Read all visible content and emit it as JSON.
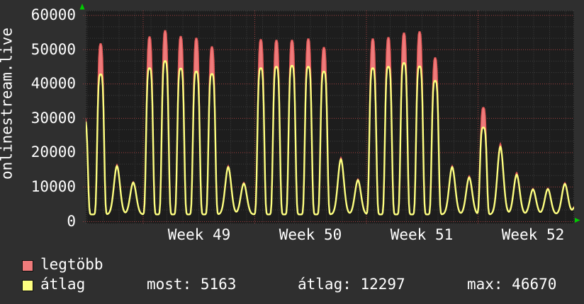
{
  "ylabel": "onlinestream.live",
  "legend": [
    {
      "label": "legtöbb",
      "color": "#ef7b7b",
      "border": "#101010"
    },
    {
      "label": "átlag",
      "color": "#feff80",
      "border": "#101010"
    }
  ],
  "stats": [
    {
      "label": "most:",
      "value": "5163"
    },
    {
      "label": "átlag:",
      "value": "12297"
    },
    {
      "label": "max:",
      "value": "46670"
    }
  ],
  "chart_data": {
    "type": "area",
    "title": "",
    "ylabel": "onlinestream.live",
    "xlabel": "",
    "ylim": [
      0,
      60000
    ],
    "ytick_step": 10000,
    "ytick_labels": [
      "0",
      "10000",
      "20000",
      "30000",
      "40000",
      "50000",
      "60000"
    ],
    "x_tick_labels": [
      "Week 49",
      "Week 50",
      "Week 51",
      "Week 52"
    ],
    "grid": true,
    "legend_position": "bottom-left",
    "colors": {
      "max_fill": "#ef7b7b",
      "max_line": "#e25454",
      "avg_line": "#feff80",
      "grid_minor": "#3e3e3e",
      "grid_major": "#9e4040",
      "plot_bg": "#1d1d1d",
      "page_bg": "#2f2f2f",
      "arrow": "#00cc00",
      "text": "#ffffff"
    },
    "baseline": 2000,
    "series": [
      {
        "name": "legtöbb",
        "kind": "band-max",
        "color": "#ef7b7b"
      },
      {
        "name": "átlag",
        "kind": "line-avg",
        "color": "#feff80"
      }
    ],
    "days": [
      {
        "off": -2,
        "max": 30500,
        "avg": 29500,
        "shape": "spike"
      },
      {
        "off": 21,
        "max": 51800,
        "avg": 42800,
        "shape": "spike"
      },
      {
        "off": 44,
        "max": 16600,
        "avg": 16100,
        "shape": "bump"
      },
      {
        "off": 67,
        "max": 11600,
        "avg": 11300,
        "shape": "bump"
      },
      {
        "off": 90,
        "max": 53800,
        "avg": 44600,
        "shape": "spike"
      },
      {
        "off": 112,
        "max": 55600,
        "avg": 46670,
        "shape": "spike"
      },
      {
        "off": 134,
        "max": 53900,
        "avg": 44500,
        "shape": "spike"
      },
      {
        "off": 156,
        "max": 53400,
        "avg": 43600,
        "shape": "spike"
      },
      {
        "off": 178,
        "max": 50900,
        "avg": 42900,
        "shape": "spike"
      },
      {
        "off": 201,
        "max": 16300,
        "avg": 15800,
        "shape": "bump"
      },
      {
        "off": 223,
        "max": 11400,
        "avg": 11000,
        "shape": "bump"
      },
      {
        "off": 247,
        "max": 53000,
        "avg": 44600,
        "shape": "spike"
      },
      {
        "off": 269,
        "max": 52800,
        "avg": 45000,
        "shape": "spike"
      },
      {
        "off": 291,
        "max": 52800,
        "avg": 45300,
        "shape": "spike"
      },
      {
        "off": 314,
        "max": 53200,
        "avg": 45000,
        "shape": "spike"
      },
      {
        "off": 336,
        "max": 50700,
        "avg": 43600,
        "shape": "spike"
      },
      {
        "off": 360,
        "max": 18700,
        "avg": 18100,
        "shape": "bump"
      },
      {
        "off": 384,
        "max": 12400,
        "avg": 12000,
        "shape": "bump"
      },
      {
        "off": 405,
        "max": 53200,
        "avg": 44600,
        "shape": "spike"
      },
      {
        "off": 427,
        "max": 53600,
        "avg": 45000,
        "shape": "spike"
      },
      {
        "off": 449,
        "max": 54900,
        "avg": 46100,
        "shape": "spike"
      },
      {
        "off": 471,
        "max": 55300,
        "avg": 45100,
        "shape": "spike"
      },
      {
        "off": 493,
        "max": 47700,
        "avg": 40900,
        "shape": "spike"
      },
      {
        "off": 517,
        "max": 16300,
        "avg": 15800,
        "shape": "bump"
      },
      {
        "off": 541,
        "max": 13300,
        "avg": 12800,
        "shape": "bump"
      },
      {
        "off": 561,
        "max": 33200,
        "avg": 27300,
        "shape": "spike"
      },
      {
        "off": 585,
        "max": 22800,
        "avg": 21800,
        "shape": "bump"
      },
      {
        "off": 608,
        "max": 14300,
        "avg": 13600,
        "shape": "bump"
      },
      {
        "off": 631,
        "max": 9600,
        "avg": 9300,
        "shape": "bump"
      },
      {
        "off": 652,
        "max": 9700,
        "avg": 9400,
        "shape": "bump"
      },
      {
        "off": 676,
        "max": 11300,
        "avg": 10900,
        "shape": "bump"
      },
      {
        "off": 693,
        "max": 5600,
        "avg": 5163,
        "shape": "bump"
      }
    ],
    "week_grid_off": [
      81,
      238.5,
      396,
      553.5
    ],
    "week_label_center_off": [
      160,
      317,
      474,
      631
    ],
    "day_grid": {
      "start_off": 2,
      "step": 22.5,
      "count": 31
    }
  }
}
